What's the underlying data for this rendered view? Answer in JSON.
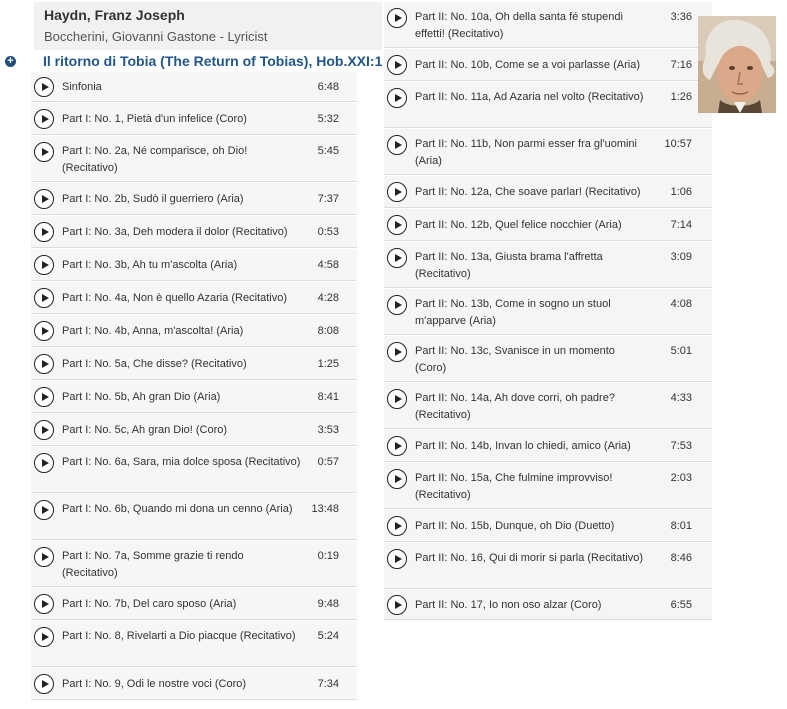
{
  "header": {
    "composer": "Haydn, Franz Joseph",
    "lyricist": "Boccherini, Giovanni Gastone - Lyricist"
  },
  "work": {
    "title": "Il ritorno di Tobia (The Return of Tobias), Hob.XXI:1"
  },
  "tracks_left": [
    {
      "name": "Sinfonia",
      "duration": "6:48"
    },
    {
      "name": "Part I: No. 1, Pietà d'un infelice (Coro)",
      "duration": "5:32"
    },
    {
      "name": "Part I: No. 2a, Né comparisce, oh Dio! (Recitativo)",
      "duration": "5:45"
    },
    {
      "name": "Part I: No. 2b, Sudò il guerriero (Aria)",
      "duration": "7:37"
    },
    {
      "name": "Part I: No. 3a, Deh modera il dolor (Recitativo)",
      "duration": "0:53"
    },
    {
      "name": "Part I: No. 3b, Ah tu m'ascolta (Aria)",
      "duration": "4:58"
    },
    {
      "name": "Part I: No. 4a, Non è quello Azaria (Recitativo)",
      "duration": "4:28"
    },
    {
      "name": "Part I: No. 4b, Anna, m'ascolta! (Aria)",
      "duration": "8:08"
    },
    {
      "name": "Part I: No. 5a, Che disse? (Recitativo)",
      "duration": "1:25"
    },
    {
      "name": "Part I: No. 5b, Ah gran Dio (Aria)",
      "duration": "8:41"
    },
    {
      "name": "Part I: No. 5c, Ah gran Dio! (Coro)",
      "duration": "3:53"
    },
    {
      "name": "Part I: No. 6a, Sara, mia dolce sposa (Recitativo)",
      "duration": "0:57"
    },
    {
      "name": "Part I: No. 6b, Quando mi dona un cenno (Aria)",
      "duration": "13:48"
    },
    {
      "name": "Part I: No. 7a, Somme grazie ti rendo (Recitativo)",
      "duration": "0:19"
    },
    {
      "name": "Part I: No. 7b, Del caro sposo (Aria)",
      "duration": "9:48"
    },
    {
      "name": "Part I: No. 8, Rivelarti a Dio piacque (Recitativo)",
      "duration": "5:24"
    },
    {
      "name": "Part I: No. 9, Odi le nostre voci (Coro)",
      "duration": "7:34"
    }
  ],
  "tracks_right": [
    {
      "name": "Part II: No. 10a, Oh della santa fé stupendi effetti! (Recitativo)",
      "duration": "3:36"
    },
    {
      "name": "Part II: No. 10b, Come se a voi parlasse (Aria)",
      "duration": "7:16"
    },
    {
      "name": "Part II: No. 11a, Ad Azaria nel volto (Recitativo)",
      "duration": "1:26"
    },
    {
      "name": "Part II: No. 11b, Non parmi esser fra gl'uomini (Aria)",
      "duration": "10:57"
    },
    {
      "name": "Part II: No. 12a, Che soave parlar! (Recitativo)",
      "duration": "1:06"
    },
    {
      "name": "Part II: No. 12b, Quel felice nocchier (Aria)",
      "duration": "7:14"
    },
    {
      "name": "Part II: No. 13a, Giusta brama l'affretta (Recitativo)",
      "duration": "3:09"
    },
    {
      "name": "Part II: No. 13b, Come in sogno un stuol m'apparve (Aria)",
      "duration": "4:08"
    },
    {
      "name": "Part II: No. 13c, Svanisce in un momento (Coro)",
      "duration": "5:01"
    },
    {
      "name": "Part II: No. 14a, Ah dove corri, oh padre? (Recitativo)",
      "duration": "4:33"
    },
    {
      "name": "Part II: No. 14b, Invan lo chiedi, amico (Aria)",
      "duration": "7:53"
    },
    {
      "name": "Part II: No. 15a, Che fulmine improvviso! (Recitativo)",
      "duration": "2:03"
    },
    {
      "name": "Part II: No. 15b, Dunque, oh Dio (Duetto)",
      "duration": "8:01"
    },
    {
      "name": "Part II: No. 16, Qui di morir si parla (Recitativo)",
      "duration": "8:46"
    },
    {
      "name": "Part II: No. 17, Io non oso alzar (Coro)",
      "duration": "6:55"
    }
  ]
}
